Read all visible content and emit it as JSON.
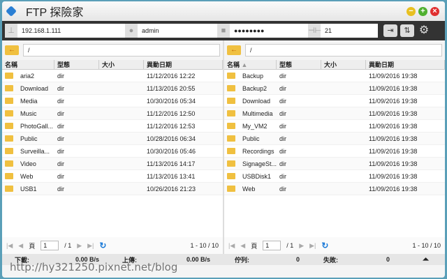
{
  "app": {
    "title": "FTP 探險家"
  },
  "connection": {
    "host": "192.168.1.111",
    "user": "admin",
    "password": "●●●●●●●●",
    "port": "21"
  },
  "columns": {
    "name": "名稱",
    "type": "型態",
    "size": "大小",
    "modified": "異動日期"
  },
  "left": {
    "path": "/",
    "rows": [
      {
        "name": "aria2",
        "type": "dir",
        "size": "",
        "modified": "11/12/2016 12:22"
      },
      {
        "name": "Download",
        "type": "dir",
        "size": "",
        "modified": "11/13/2016 20:55"
      },
      {
        "name": "Media",
        "type": "dir",
        "size": "",
        "modified": "10/30/2016 05:34"
      },
      {
        "name": "Music",
        "type": "dir",
        "size": "",
        "modified": "11/12/2016 12:50"
      },
      {
        "name": "PhotoGall...",
        "type": "dir",
        "size": "",
        "modified": "11/12/2016 12:53"
      },
      {
        "name": "Public",
        "type": "dir",
        "size": "",
        "modified": "10/28/2016 06:34"
      },
      {
        "name": "Surveilla...",
        "type": "dir",
        "size": "",
        "modified": "10/30/2016 05:46"
      },
      {
        "name": "Video",
        "type": "dir",
        "size": "",
        "modified": "11/13/2016 14:17"
      },
      {
        "name": "Web",
        "type": "dir",
        "size": "",
        "modified": "11/13/2016 13:41"
      },
      {
        "name": "USB1",
        "type": "dir",
        "size": "",
        "modified": "10/26/2016 21:23"
      }
    ],
    "pager": {
      "page_label": "頁",
      "page": "1",
      "total": "/ 1",
      "count": "1 - 10 / 10"
    }
  },
  "right": {
    "path": "/",
    "rows": [
      {
        "name": "Backup",
        "type": "dir",
        "size": "",
        "modified": "11/09/2016 19:38"
      },
      {
        "name": "Backup2",
        "type": "dir",
        "size": "",
        "modified": "11/09/2016 19:38"
      },
      {
        "name": "Download",
        "type": "dir",
        "size": "",
        "modified": "11/09/2016 19:38"
      },
      {
        "name": "Multimedia",
        "type": "dir",
        "size": "",
        "modified": "11/09/2016 19:38"
      },
      {
        "name": "My_VM2",
        "type": "dir",
        "size": "",
        "modified": "11/09/2016 19:38"
      },
      {
        "name": "Public",
        "type": "dir",
        "size": "",
        "modified": "11/09/2016 19:38"
      },
      {
        "name": "Recordings",
        "type": "dir",
        "size": "",
        "modified": "11/09/2016 19:38"
      },
      {
        "name": "SignageSt...",
        "type": "dir",
        "size": "",
        "modified": "11/09/2016 19:38"
      },
      {
        "name": "USBDisk1",
        "type": "dir",
        "size": "",
        "modified": "11/09/2016 19:38"
      },
      {
        "name": "Web",
        "type": "dir",
        "size": "",
        "modified": "11/09/2016 19:38"
      }
    ],
    "pager": {
      "page_label": "頁",
      "page": "1",
      "total": "/ 1",
      "count": "1 - 10 / 10"
    }
  },
  "status": {
    "download_label": "下載:",
    "download": "0.00 B/s",
    "upload_label": "上傳:",
    "upload": "0.00 B/s",
    "queue_label": "佇列:",
    "queue": "0",
    "failed_label": "失敗:",
    "failed": "0"
  },
  "watermark": "http://hy321250.pixnet.net/blog"
}
